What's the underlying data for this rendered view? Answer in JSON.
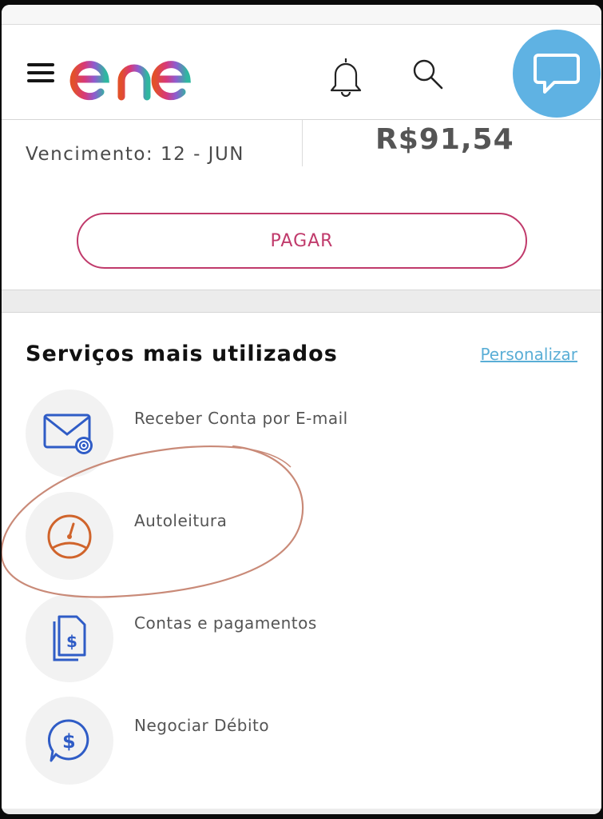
{
  "header": {
    "logo_text": "enel"
  },
  "bill": {
    "due_label": "Vencimento: 12 - JUN",
    "amount": "R$91,54",
    "pay_label": "PAGAR"
  },
  "services": {
    "title": "Serviços mais utilizados",
    "customize_label": "Personalizar",
    "items": [
      {
        "label": "Receber Conta por E-mail",
        "icon": "email-icon"
      },
      {
        "label": "Autoleitura",
        "icon": "meter-gauge-icon"
      },
      {
        "label": "Contas e pagamentos",
        "icon": "invoice-icon"
      },
      {
        "label": "Negociar Débito",
        "icon": "dollar-chat-icon"
      }
    ]
  },
  "colors": {
    "accent_pink": "#c03a6b",
    "chat_blue": "#5fb2e3",
    "link_blue": "#5aaed6",
    "icon_blue": "#2f5cc6",
    "icon_orange": "#d0642b",
    "annotation_red": "#c98a78"
  }
}
